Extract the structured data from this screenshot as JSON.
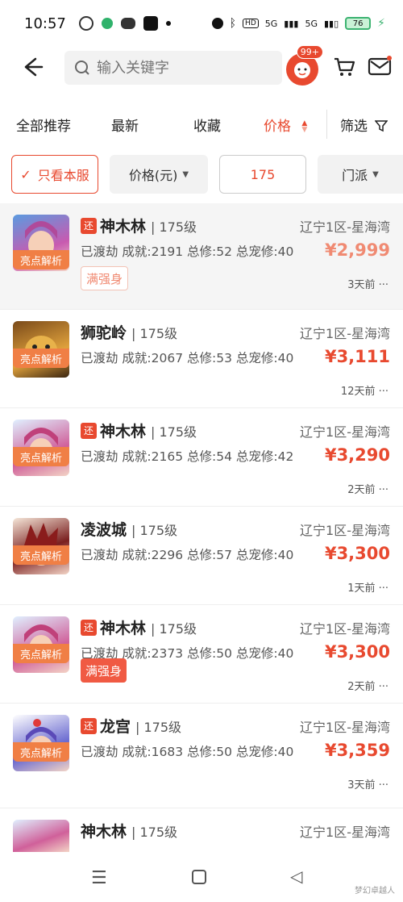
{
  "status_bar": {
    "time": "10:57",
    "battery": "76",
    "net1": "5G",
    "net2": "5G"
  },
  "colors": {
    "accent": "#e8492f",
    "tag_orange": "#f07f45"
  },
  "header": {
    "search_placeholder": "输入关键字",
    "badge": "99+"
  },
  "sort_tabs": [
    "全部推荐",
    "最新",
    "收藏",
    "价格",
    "筛选"
  ],
  "filters": {
    "only_this_server": "只看本服",
    "price_unit": "价格(元)",
    "price_value": "175",
    "school": "门派"
  },
  "listings": [
    {
      "huan": "还",
      "school": "神木林",
      "level": "| 175级",
      "server": "辽宁1区-星海湾",
      "stats": "已渡劫 成就:2191 总修:52 总宠修:40",
      "price": "¥2,999",
      "time": "3天前 ···",
      "tag": "亮点解析",
      "badge": "满强身"
    },
    {
      "huan": "",
      "school": "狮驼岭",
      "level": "| 175级",
      "server": "辽宁1区-星海湾",
      "stats": "已渡劫 成就:2067 总修:53 总宠修:40",
      "price": "¥3,111",
      "time": "12天前 ···",
      "tag": "亮点解析",
      "badge": ""
    },
    {
      "huan": "还",
      "school": "神木林",
      "level": "| 175级",
      "server": "辽宁1区-星海湾",
      "stats": "已渡劫 成就:2165 总修:54 总宠修:42",
      "price": "¥3,290",
      "time": "2天前 ···",
      "tag": "亮点解析",
      "badge": ""
    },
    {
      "huan": "",
      "school": "凌波城",
      "level": "| 175级",
      "server": "辽宁1区-星海湾",
      "stats": "已渡劫 成就:2296 总修:57 总宠修:40",
      "price": "¥3,300",
      "time": "1天前 ···",
      "tag": "亮点解析",
      "badge": ""
    },
    {
      "huan": "还",
      "school": "神木林",
      "level": "| 175级",
      "server": "辽宁1区-星海湾",
      "stats": "已渡劫 成就:2373 总修:50 总宠修:40",
      "price": "¥3,300",
      "time": "2天前 ···",
      "tag": "亮点解析",
      "badge": "满强身"
    },
    {
      "huan": "还",
      "school": "龙宫",
      "level": "| 175级",
      "server": "辽宁1区-星海湾",
      "stats": "已渡劫 成就:1683 总修:50 总宠修:40",
      "price": "¥3,359",
      "time": "3天前 ···",
      "tag": "亮点解析",
      "badge": ""
    },
    {
      "huan": "",
      "school": "神木林",
      "level": "| 175级",
      "server": "辽宁1区-星海湾",
      "stats": "",
      "price": "",
      "time": "",
      "tag": "",
      "badge": ""
    }
  ],
  "watermark": "梦幻卓越人"
}
